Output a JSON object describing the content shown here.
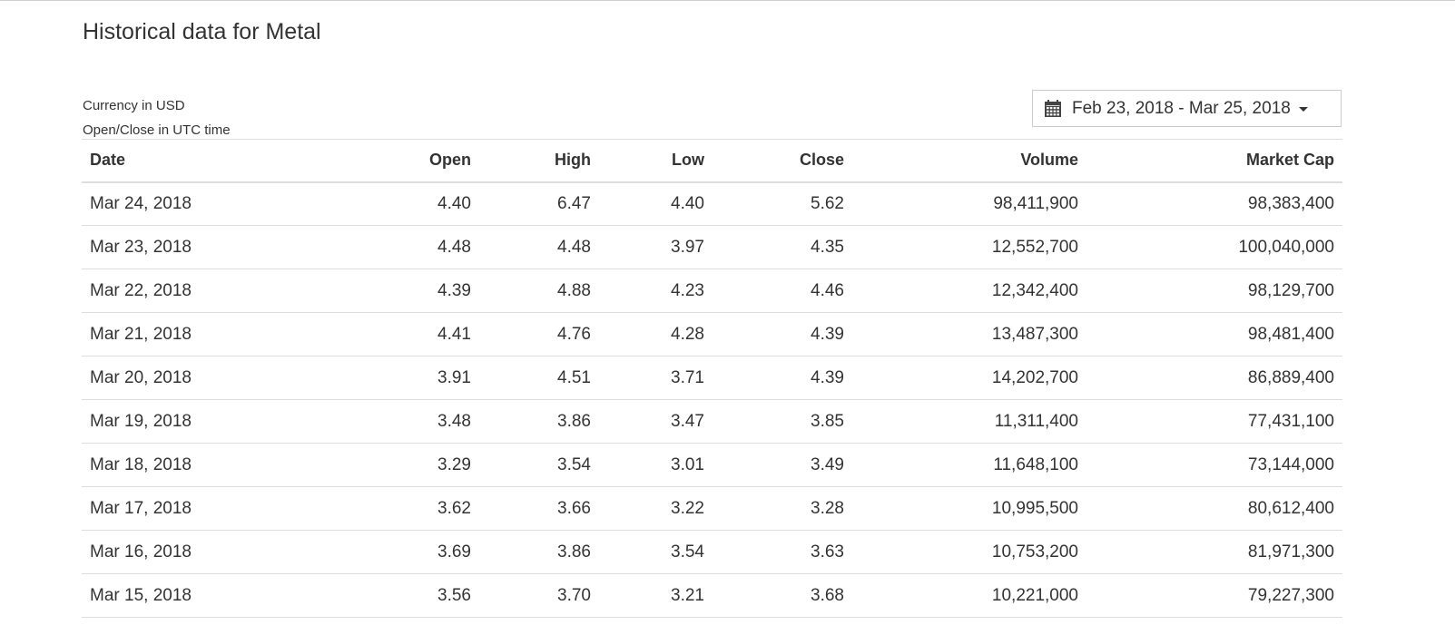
{
  "page": {
    "title": "Historical data for Metal",
    "currency_note": "Currency in USD",
    "time_note": "Open/Close in UTC time"
  },
  "date_range": {
    "icon": "calendar-icon",
    "label": "Feb 23, 2018 - Mar 25, 2018"
  },
  "table": {
    "headers": {
      "date": "Date",
      "open": "Open",
      "high": "High",
      "low": "Low",
      "close": "Close",
      "volume": "Volume",
      "market_cap": "Market Cap"
    },
    "rows": [
      {
        "date": "Mar 24, 2018",
        "open": "4.40",
        "high": "6.47",
        "low": "4.40",
        "close": "5.62",
        "volume": "98,411,900",
        "market_cap": "98,383,400"
      },
      {
        "date": "Mar 23, 2018",
        "open": "4.48",
        "high": "4.48",
        "low": "3.97",
        "close": "4.35",
        "volume": "12,552,700",
        "market_cap": "100,040,000"
      },
      {
        "date": "Mar 22, 2018",
        "open": "4.39",
        "high": "4.88",
        "low": "4.23",
        "close": "4.46",
        "volume": "12,342,400",
        "market_cap": "98,129,700"
      },
      {
        "date": "Mar 21, 2018",
        "open": "4.41",
        "high": "4.76",
        "low": "4.28",
        "close": "4.39",
        "volume": "13,487,300",
        "market_cap": "98,481,400"
      },
      {
        "date": "Mar 20, 2018",
        "open": "3.91",
        "high": "4.51",
        "low": "3.71",
        "close": "4.39",
        "volume": "14,202,700",
        "market_cap": "86,889,400"
      },
      {
        "date": "Mar 19, 2018",
        "open": "3.48",
        "high": "3.86",
        "low": "3.47",
        "close": "3.85",
        "volume": "11,311,400",
        "market_cap": "77,431,100"
      },
      {
        "date": "Mar 18, 2018",
        "open": "3.29",
        "high": "3.54",
        "low": "3.01",
        "close": "3.49",
        "volume": "11,648,100",
        "market_cap": "73,144,000"
      },
      {
        "date": "Mar 17, 2018",
        "open": "3.62",
        "high": "3.66",
        "low": "3.22",
        "close": "3.28",
        "volume": "10,995,500",
        "market_cap": "80,612,400"
      },
      {
        "date": "Mar 16, 2018",
        "open": "3.69",
        "high": "3.86",
        "low": "3.54",
        "close": "3.63",
        "volume": "10,753,200",
        "market_cap": "81,971,300"
      },
      {
        "date": "Mar 15, 2018",
        "open": "3.56",
        "high": "3.70",
        "low": "3.21",
        "close": "3.68",
        "volume": "10,221,000",
        "market_cap": "79,227,300"
      }
    ]
  }
}
